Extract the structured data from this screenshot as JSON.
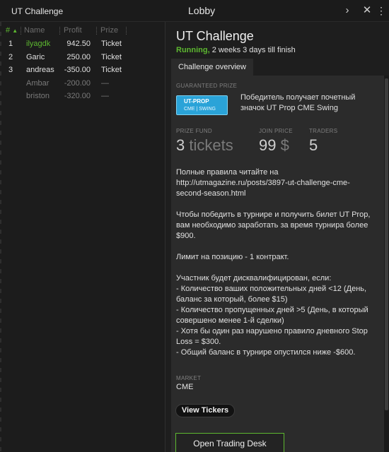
{
  "window": {
    "app_title": "UT Challenge",
    "title": "Lobby",
    "buttons": {
      "chevron": "›",
      "close": "✕",
      "more": "⋮"
    }
  },
  "leaderboard": {
    "columns": {
      "num": "#",
      "name": "Name",
      "profit": "Profit",
      "prize": "Prize"
    },
    "sort_indicator": "▲",
    "rows": [
      {
        "rank": "1",
        "name": "ilyagdk",
        "profit": "942.50",
        "prize": "Ticket"
      },
      {
        "rank": "2",
        "name": "Garic",
        "profit": "250.00",
        "prize": "Ticket"
      },
      {
        "rank": "3",
        "name": "andreas",
        "profit": "-350.00",
        "prize": "Ticket"
      },
      {
        "rank": "",
        "name": "Ambar",
        "profit": "-200.00",
        "prize": "—"
      },
      {
        "rank": "",
        "name": "briston",
        "profit": "-320.00",
        "prize": "—"
      }
    ]
  },
  "challenge": {
    "title": "UT Challenge",
    "status": "Running,",
    "status_rest": " 2 weeks 3 days till finish",
    "tab": "Challenge overview",
    "guaranteed_prize_label": "GUARANTEED PRIZE",
    "badge_top": "UT-PROP",
    "badge_bottom": "CME | SWING",
    "prize_description": "Победитель получает почетный значок UT Prop CME Swing",
    "prize_fund_label": "PRIZE FUND",
    "prize_fund_value": "3",
    "prize_fund_unit": "tickets",
    "join_price_label": "JOIN PRICE",
    "join_price_value": "99",
    "join_price_unit": "$",
    "traders_label": "TRADERS",
    "traders_value": "5",
    "rules": "Полные правила читайте на\nhttp://utmagazine.ru/posts/3897-ut-challenge-cme-second-season.html\n\nЧтобы победить в турнире и получить билет UT Prop, вам необходимо заработать за время турнира более $900.\n\nЛимит на позицию - 1 контракт.\n\nУчастник будет дисквалифицирован, если:\n- Количество ваших положительных дней <12 (День, баланс за который, более $15)\n- Количество пропущенных дней >5 (День, в который совершено менее 1-й сделки)\n- Хотя бы один раз нарушено правило дневного Stop Loss = $300.\n- Общий баланс в турнире опустился ниже -$600.",
    "market_label": "MARKET",
    "market_value": "CME",
    "view_tickers": "View Tickers",
    "open_trading_desk": "Open Trading Desk"
  },
  "colors": {
    "accent": "#5db830",
    "badge": "#2aa3d8",
    "panel": "#2b2b2b",
    "background": "#1e1e1e"
  }
}
